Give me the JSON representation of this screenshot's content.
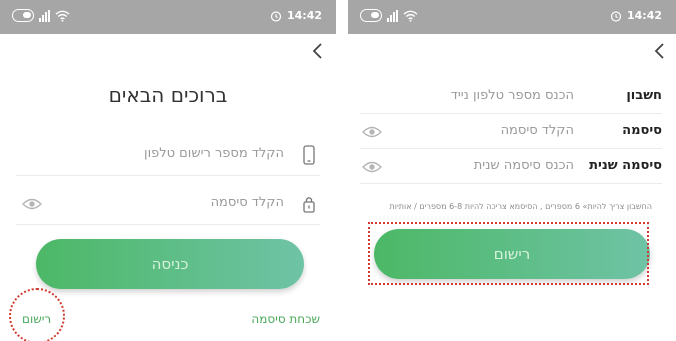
{
  "status_bar": {
    "time": "14:42"
  },
  "login_screen": {
    "title": "ברוכים הבאים",
    "phone_placeholder": "הקלד מספר רישום טלפון",
    "password_placeholder": "הקלד סיסמה",
    "login_button": "כניסה",
    "register_link": "רישום",
    "forgot_password_link": "שכחת סיסמה"
  },
  "register_screen": {
    "account_label": "חשבון",
    "account_placeholder": "הכנס מספר טלפון נייד",
    "password_label": "סיסמה",
    "password_placeholder": "הקלד סיסמה",
    "confirm_label": "סיסמה שנית",
    "confirm_placeholder": "הכנס סיסמה שנית",
    "hint": "החשבון צריך להיות» 6 מספרים , הסיסמא צריכה להיות 6-8 מספרים / אותיות",
    "register_button": "רישום"
  },
  "colors": {
    "status_bar": "#a6a6a6",
    "button_gradient_start": "#4cb866",
    "button_gradient_end": "#6fc3a6",
    "link_green": "#4aa85b",
    "highlight_red": "#d23a2f"
  },
  "icons": [
    "battery-icon",
    "signal-icon",
    "wifi-icon",
    "alarm-icon",
    "back-icon",
    "phone-icon",
    "lock-icon",
    "eye-icon"
  ]
}
